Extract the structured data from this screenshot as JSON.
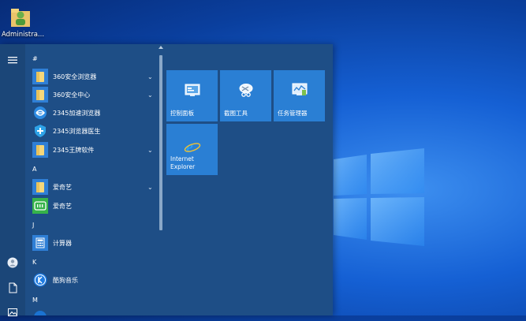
{
  "desktop": {
    "icon_label": "Administra..."
  },
  "start_menu": {
    "groups": [
      {
        "header": "#",
        "items": [
          {
            "label": "360安全浏览器",
            "icon": "folder-icon",
            "expandable": true
          },
          {
            "label": "360安全中心",
            "icon": "folder-icon",
            "expandable": true
          },
          {
            "label": "2345加速浏览器",
            "icon": "2345-browser-icon",
            "expandable": false
          },
          {
            "label": "2345浏览器医生",
            "icon": "shield-icon",
            "expandable": false
          },
          {
            "label": "2345王牌软件",
            "icon": "folder-icon",
            "expandable": true
          }
        ]
      },
      {
        "header": "A",
        "items": [
          {
            "label": "爱奇艺",
            "icon": "folder-icon",
            "expandable": true
          },
          {
            "label": "爱奇艺",
            "icon": "iqiyi-icon",
            "expandable": false
          }
        ]
      },
      {
        "header": "J",
        "items": [
          {
            "label": "计算器",
            "icon": "calculator-icon",
            "expandable": false
          }
        ]
      },
      {
        "header": "K",
        "items": [
          {
            "label": "酷狗音乐",
            "icon": "kugou-icon",
            "expandable": false
          }
        ]
      },
      {
        "header": "M",
        "items": []
      }
    ],
    "tiles": [
      {
        "label": "控制面板",
        "icon": "control-panel-icon"
      },
      {
        "label": "截图工具",
        "icon": "snipping-tool-icon"
      },
      {
        "label": "任务管理器",
        "icon": "task-manager-icon"
      },
      {
        "label_line1": "Internet",
        "label_line2": "Explorer",
        "icon": "internet-explorer-icon"
      }
    ]
  }
}
